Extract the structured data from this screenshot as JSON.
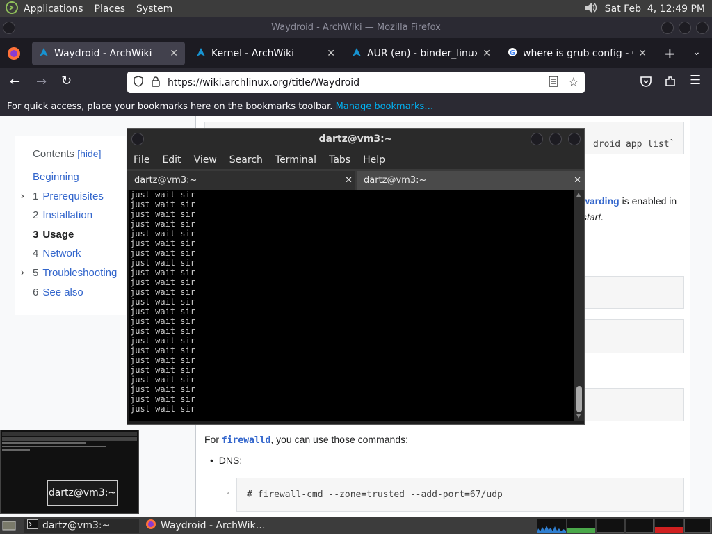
{
  "top_panel": {
    "menus": [
      "Applications",
      "Places",
      "System"
    ],
    "clock": "Sat Feb  4, 12:49 PM"
  },
  "firefox": {
    "window_title": "Waydroid - ArchWiki — Mozilla Firefox",
    "tabs": [
      {
        "label": "Waydroid - ArchWiki",
        "active": true
      },
      {
        "label": "Kernel - ArchWiki",
        "active": false
      },
      {
        "label": "AUR (en) - binder_linux-dkms",
        "active": false
      },
      {
        "label": "where is grub config - Google",
        "active": false
      }
    ],
    "url": "https://wiki.archlinux.org/title/Waydroid",
    "bookmarks_text": "For quick access, place your bookmarks here on the bookmarks toolbar.",
    "bookmarks_link": "Manage bookmarks…"
  },
  "toc": {
    "title": "Contents",
    "hide": "[hide]",
    "items": [
      {
        "num": "",
        "label": "Beginning",
        "expandable": false,
        "current": false
      },
      {
        "num": "1",
        "label": "Prerequisites",
        "expandable": true,
        "current": false
      },
      {
        "num": "2",
        "label": "Installation",
        "expandable": false,
        "current": false
      },
      {
        "num": "3",
        "label": "Usage",
        "expandable": false,
        "current": true
      },
      {
        "num": "4",
        "label": "Network",
        "expandable": false,
        "current": false
      },
      {
        "num": "5",
        "label": "Troubleshooting",
        "expandable": true,
        "current": false
      },
      {
        "num": "6",
        "label": "See also",
        "expandable": false,
        "current": false
      }
    ]
  },
  "content": {
    "code_top": "droid app list`",
    "frag_link": "warding",
    "frag_text": "is enabled in",
    "frag_italic": "start.",
    "firewalld_pre": "For",
    "firewalld_code": "firewalld",
    "firewalld_post": ", you can use those commands:",
    "bullet": "DNS:",
    "dns_cmd": "# firewall-cmd --zone=trusted --add-port=67/udp"
  },
  "terminal": {
    "title": "dartz@vm3:~",
    "menu": [
      "File",
      "Edit",
      "View",
      "Search",
      "Terminal",
      "Tabs",
      "Help"
    ],
    "tabs": [
      "dartz@vm3:~",
      "dartz@vm3:~"
    ],
    "lines": [
      "just wait sir",
      "just wait sir",
      "just wait sir",
      "just wait sir",
      "just wait sir",
      "just wait sir",
      "just wait sir",
      "just wait sir",
      "just wait sir",
      "just wait sir",
      "just wait sir",
      "just wait sir",
      "just wait sir",
      "just wait sir",
      "just wait sir",
      "just wait sir",
      "just wait sir",
      "just wait sir",
      "just wait sir",
      "just wait sir",
      "just wait sir",
      "just wait sir",
      "just wait sir"
    ]
  },
  "thumbnail": {
    "label": "dartz@vm3:~"
  },
  "taskbar": {
    "items": [
      "dartz@vm3:~",
      "Waydroid - ArchWik…"
    ]
  }
}
